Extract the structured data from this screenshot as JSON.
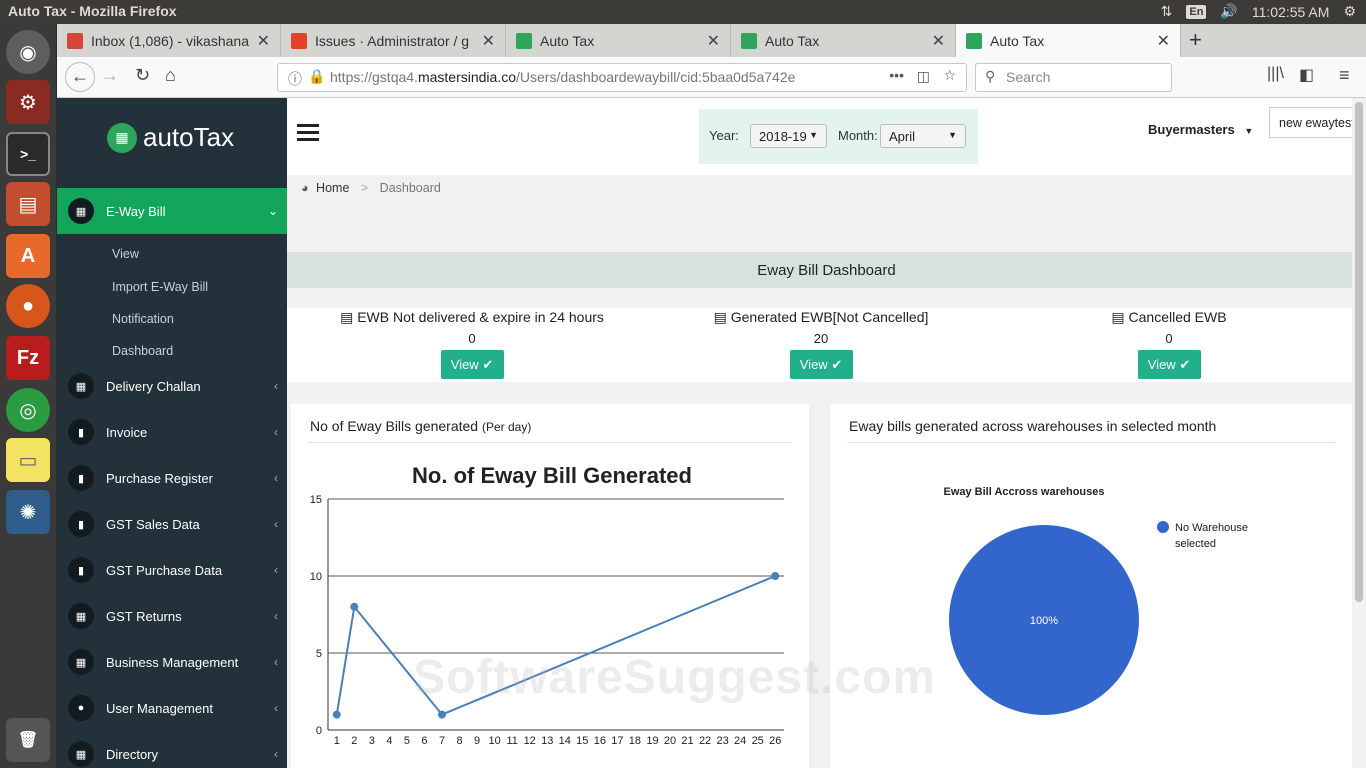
{
  "os": {
    "window_title": "Auto Tax - Mozilla Firefox",
    "keyboard_layout": "En",
    "clock": "11:02:55 AM"
  },
  "browser": {
    "tabs": [
      {
        "label": "Inbox (1,086) - vikashana",
        "icon": "gmail-icon",
        "color": "#d44638"
      },
      {
        "label": "Issues · Administrator / g",
        "icon": "gitlab-icon",
        "color": "#e24329"
      },
      {
        "label": "Auto Tax",
        "icon": "autotax-favicon",
        "color": "#2fa55b"
      },
      {
        "label": "Auto Tax",
        "icon": "autotax-favicon",
        "color": "#2fa55b"
      },
      {
        "label": "Auto Tax",
        "icon": "autotax-favicon",
        "color": "#2fa55b"
      }
    ],
    "url_prefix": "https://gstqa4.",
    "url_domain": "mastersindia.co",
    "url_path": "/Users/dashboardewaybill/cid:5baa0d5a742e",
    "search_placeholder": "Search"
  },
  "app": {
    "logo_text": "autoTax",
    "sidebar": {
      "items": [
        {
          "label": "E-Way Bill",
          "icon": "calendar-icon",
          "active": true
        },
        {
          "label": "Delivery Challan",
          "icon": "calendar-icon"
        },
        {
          "label": "Invoice",
          "icon": "book-icon"
        },
        {
          "label": "Purchase Register",
          "icon": "book-icon"
        },
        {
          "label": "GST Sales Data",
          "icon": "book-icon"
        },
        {
          "label": "GST Purchase Data",
          "icon": "book-icon"
        },
        {
          "label": "GST Returns",
          "icon": "grid-icon"
        },
        {
          "label": "Business Management",
          "icon": "grid-icon"
        },
        {
          "label": "User Management",
          "icon": "user-icon"
        },
        {
          "label": "Directory",
          "icon": "calendar-icon"
        }
      ],
      "subitems": [
        "View",
        "Import E-Way Bill",
        "Notification",
        "Dashboard"
      ]
    },
    "header": {
      "year_label": "Year:",
      "year_value": "2018-19",
      "month_label": "Month:",
      "month_value": "April",
      "user": "Buyermasters",
      "ewaybox": "new ewaytest"
    },
    "breadcrumb": {
      "home": "Home",
      "current": "Dashboard"
    },
    "dashboard_title": "Eway Bill Dashboard",
    "stats": [
      {
        "label": "EWB Not delivered & expire in 24 hours",
        "value": "0",
        "button": "View"
      },
      {
        "label": "Generated EWB[Not Cancelled]",
        "value": "20",
        "button": "View"
      },
      {
        "label": "Cancelled EWB",
        "value": "0",
        "button": "View"
      }
    ],
    "panels": {
      "left_title": "No of Eway Bills generated",
      "left_title_suffix": "(Per day)",
      "right_title": "Eway bills generated across warehouses in selected month"
    },
    "watermark": "SoftwareSuggest.com"
  },
  "chart_data": [
    {
      "type": "line",
      "title": "No. of Eway Bill Generated",
      "x": [
        1,
        2,
        3,
        4,
        5,
        6,
        7,
        8,
        9,
        10,
        11,
        12,
        13,
        14,
        15,
        16,
        17,
        18,
        19,
        20,
        21,
        22,
        23,
        24,
        25,
        26
      ],
      "points": [
        {
          "x": 1,
          "y": 1
        },
        {
          "x": 2,
          "y": 8
        },
        {
          "x": 7,
          "y": 1
        },
        {
          "x": 26,
          "y": 10
        }
      ],
      "ylim": [
        0,
        15
      ],
      "yticks": [
        0,
        5,
        10,
        15
      ],
      "color": "#4a7fb8",
      "grid": true
    },
    {
      "type": "pie",
      "title": "Eway Bill Accross warehouses",
      "slices": [
        {
          "label": "No Warehouse selected",
          "value": 100,
          "color": "#3366cc"
        }
      ],
      "slice_label": "100%",
      "legend": "right"
    }
  ]
}
